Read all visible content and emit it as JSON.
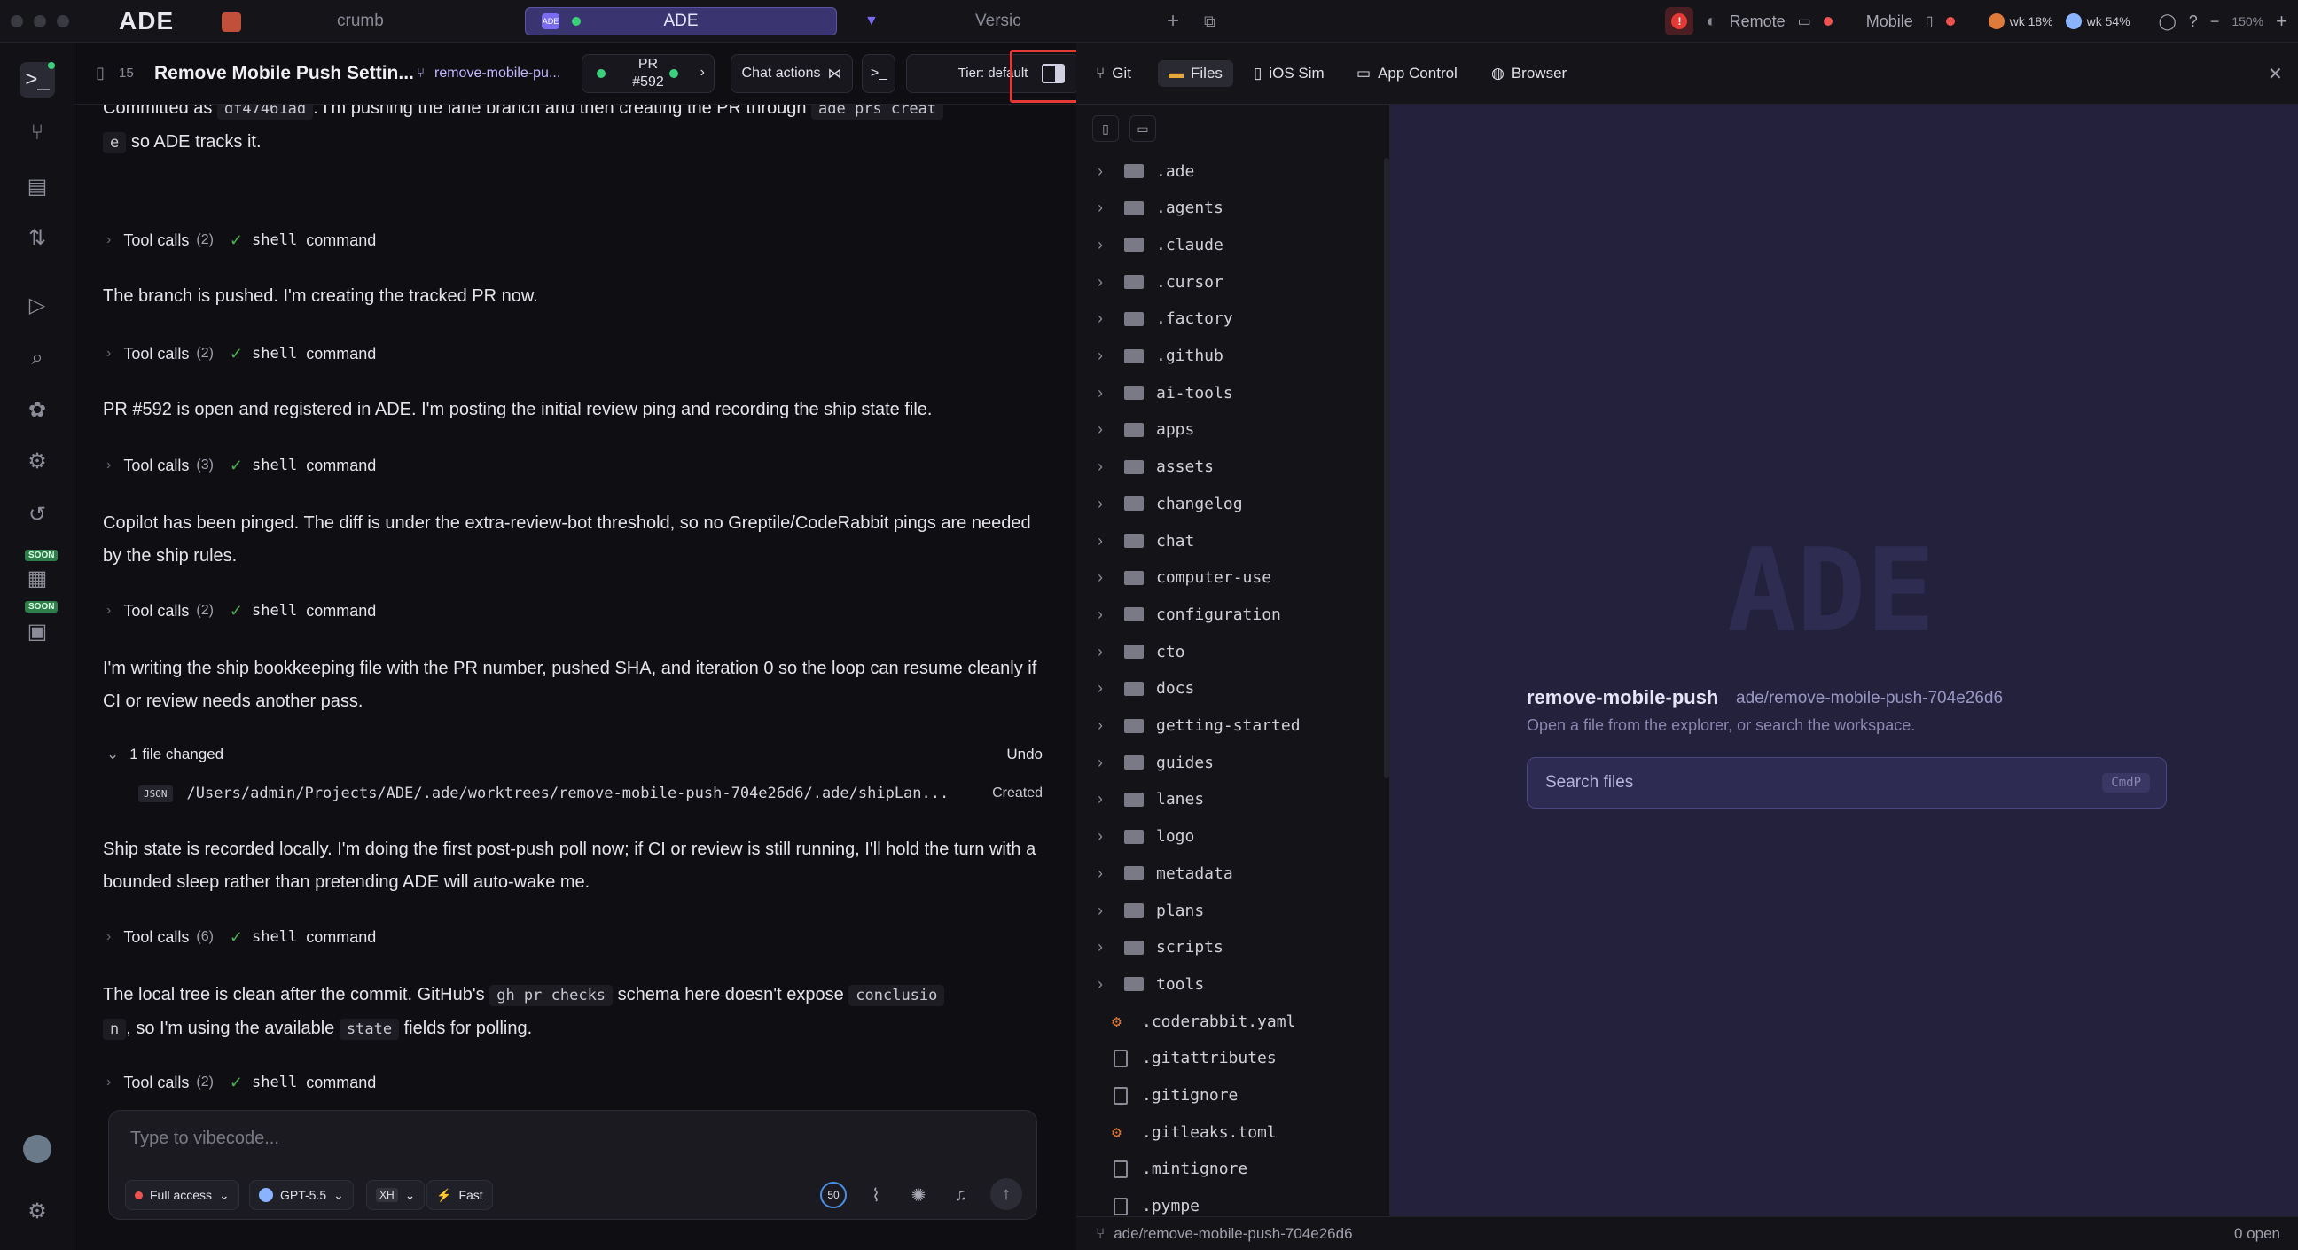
{
  "topbar": {
    "brand": "ADE",
    "tabs": [
      "crumb",
      "ADE",
      "Versic"
    ],
    "tab_badge": "ADE",
    "remote": "Remote",
    "mobile": "Mobile",
    "usage1": "wk 18%",
    "usage2": "wk 54%",
    "zoom": "150%",
    "plus": "+",
    "minus": "−",
    "alert": "!"
  },
  "chat": {
    "count": "15",
    "title": "Remove Mobile Push Settin...",
    "lane": "remove-mobile-pu...",
    "pr_label": "PR",
    "pr_number": "#592",
    "chat_actions": "Chat actions",
    "tier": "Tier: default",
    "messages": {
      "m0a": "Committed as",
      "m0_code": "df47461ad",
      "m0b": ". I'm pushing the lane branch and then creating the PR through",
      "m0_code2": "ade prs creat",
      "m0_code3": "e",
      "m0c": "so ADE tracks it.",
      "m1": "The branch is pushed. I'm creating the tracked PR now.",
      "m2": "PR #592 is open and registered in ADE. I'm posting the initial review ping and recording the ship state file.",
      "m3": "Copilot has been pinged. The diff is under the extra-review-bot threshold, so no Greptile/CodeRabbit pings are needed by the ship rules.",
      "m4": "I'm writing the ship bookkeeping file with the PR number, pushed SHA, and iteration 0 so the loop can resume cleanly if CI or review needs another pass.",
      "m5": "Ship state is recorded locally. I'm doing the first post-push poll now; if CI or review is still running, I'll hold the turn with a bounded sleep rather than pretending ADE will auto-wake me.",
      "m6a": "The local tree is clean after the commit. GitHub's",
      "m6_code1": "gh pr checks",
      "m6b": "schema here doesn't expose",
      "m6_code2": "conclusio",
      "m6_code3": "n",
      "m6c": ", so I'm using the available",
      "m6_code4": "state",
      "m6d": "fields for polling."
    },
    "tool_calls": [
      {
        "label": "Tool calls",
        "count": "(2)",
        "cmd": "shell",
        "tail": "command"
      },
      {
        "label": "Tool calls",
        "count": "(2)",
        "cmd": "shell",
        "tail": "command"
      },
      {
        "label": "Tool calls",
        "count": "(3)",
        "cmd": "shell",
        "tail": "command"
      },
      {
        "label": "Tool calls",
        "count": "(2)",
        "cmd": "shell",
        "tail": "command"
      },
      {
        "label": "Tool calls",
        "count": "(6)",
        "cmd": "shell",
        "tail": "command"
      },
      {
        "label": "Tool calls",
        "count": "(2)",
        "cmd": "shell",
        "tail": "command"
      }
    ],
    "file_changed": {
      "label": "1 file changed",
      "undo": "Undo",
      "type": "JSON",
      "path": "/Users/admin/Projects/ADE/.ade/worktrees/remove-mobile-push-704e26d6/.ade/shipLan...",
      "status": "Created"
    },
    "composer": {
      "placeholder": "Type to vibecode...",
      "access": "Full access",
      "model": "GPT-5.5",
      "effort": "XH",
      "fast": "Fast",
      "context": "50"
    }
  },
  "right": {
    "tabs": [
      "Git",
      "Files",
      "iOS Sim",
      "App Control",
      "Browser"
    ],
    "tree": [
      {
        "name": ".ade",
        "kind": "folder"
      },
      {
        "name": ".agents",
        "kind": "folder"
      },
      {
        "name": ".claude",
        "kind": "folder"
      },
      {
        "name": ".cursor",
        "kind": "folder"
      },
      {
        "name": ".factory",
        "kind": "folder"
      },
      {
        "name": ".github",
        "kind": "folder"
      },
      {
        "name": "ai-tools",
        "kind": "folder"
      },
      {
        "name": "apps",
        "kind": "folder"
      },
      {
        "name": "assets",
        "kind": "folder"
      },
      {
        "name": "changelog",
        "kind": "folder"
      },
      {
        "name": "chat",
        "kind": "folder"
      },
      {
        "name": "computer-use",
        "kind": "folder"
      },
      {
        "name": "configuration",
        "kind": "folder"
      },
      {
        "name": "cto",
        "kind": "folder"
      },
      {
        "name": "docs",
        "kind": "folder"
      },
      {
        "name": "getting-started",
        "kind": "folder"
      },
      {
        "name": "guides",
        "kind": "folder"
      },
      {
        "name": "lanes",
        "kind": "folder"
      },
      {
        "name": "logo",
        "kind": "folder"
      },
      {
        "name": "metadata",
        "kind": "folder"
      },
      {
        "name": "plans",
        "kind": "folder"
      },
      {
        "name": "scripts",
        "kind": "folder"
      },
      {
        "name": "tools",
        "kind": "folder"
      },
      {
        "name": ".coderabbit.yaml",
        "kind": "config"
      },
      {
        "name": ".gitattributes",
        "kind": "file"
      },
      {
        "name": ".gitignore",
        "kind": "file"
      },
      {
        "name": ".gitleaks.toml",
        "kind": "config"
      },
      {
        "name": ".mintignore",
        "kind": "file"
      },
      {
        "name": ".pympe",
        "kind": "file"
      }
    ],
    "editor": {
      "watermark": "ADE",
      "title": "remove-mobile-push",
      "lane": "ade/remove-mobile-push-704e26d6",
      "subtitle": "Open a file from the explorer, or search the workspace.",
      "search_placeholder": "Search files",
      "shortcut": "CmdP"
    },
    "status": {
      "branch": "ade/remove-mobile-push-704e26d6",
      "open": "0 open"
    }
  },
  "colors": {
    "accent": "#7a6cf0",
    "success": "#4caf50",
    "danger": "#e53935",
    "highlight": "#e53935"
  }
}
